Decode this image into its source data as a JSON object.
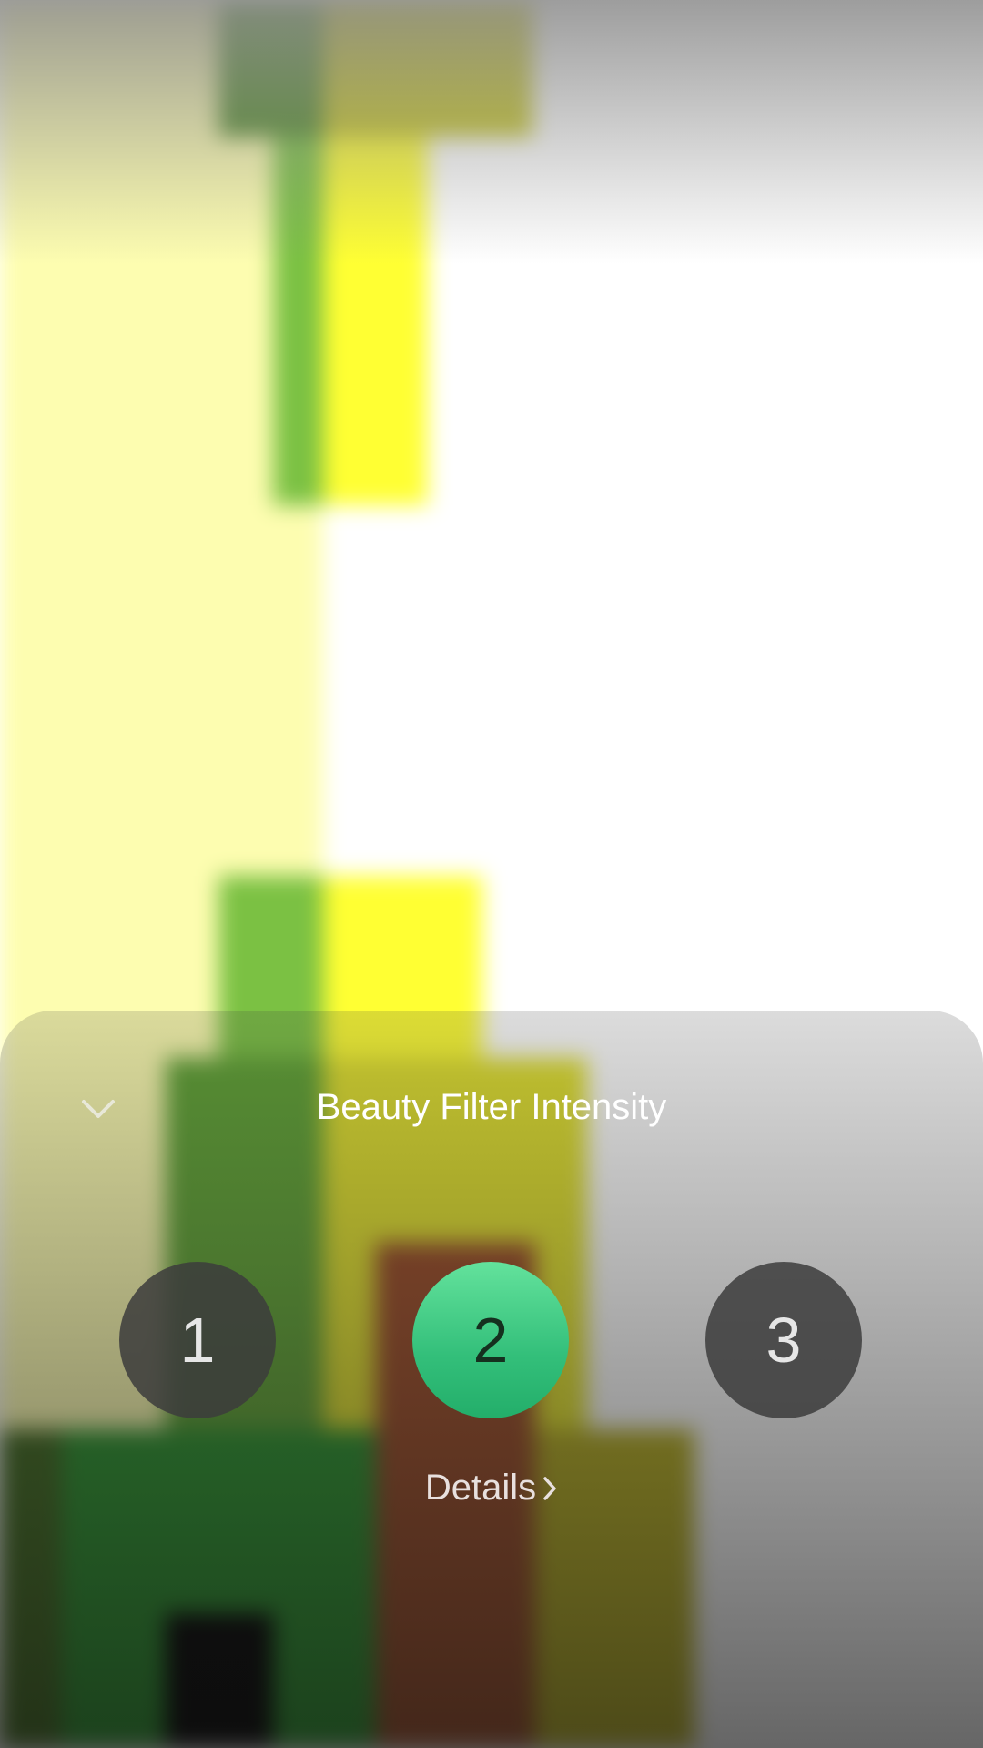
{
  "sheet": {
    "title": "Beauty Filter Intensity",
    "collapse_icon": "chevron-down-icon",
    "levels": [
      {
        "label": "1",
        "selected": false
      },
      {
        "label": "2",
        "selected": true
      },
      {
        "label": "3",
        "selected": false
      }
    ],
    "details_label": "Details",
    "details_icon": "chevron-right-icon",
    "accent_color": "#3cc985"
  },
  "preview": {
    "colors": {
      "pale_yellow": "#fdfdb0",
      "yellow": "#ffff33",
      "leaf_green": "#7bc143",
      "dark_green": "#2f8a2a",
      "olive": "#8e8a1a",
      "brown": "#9a4a25",
      "black": "#000000"
    }
  }
}
